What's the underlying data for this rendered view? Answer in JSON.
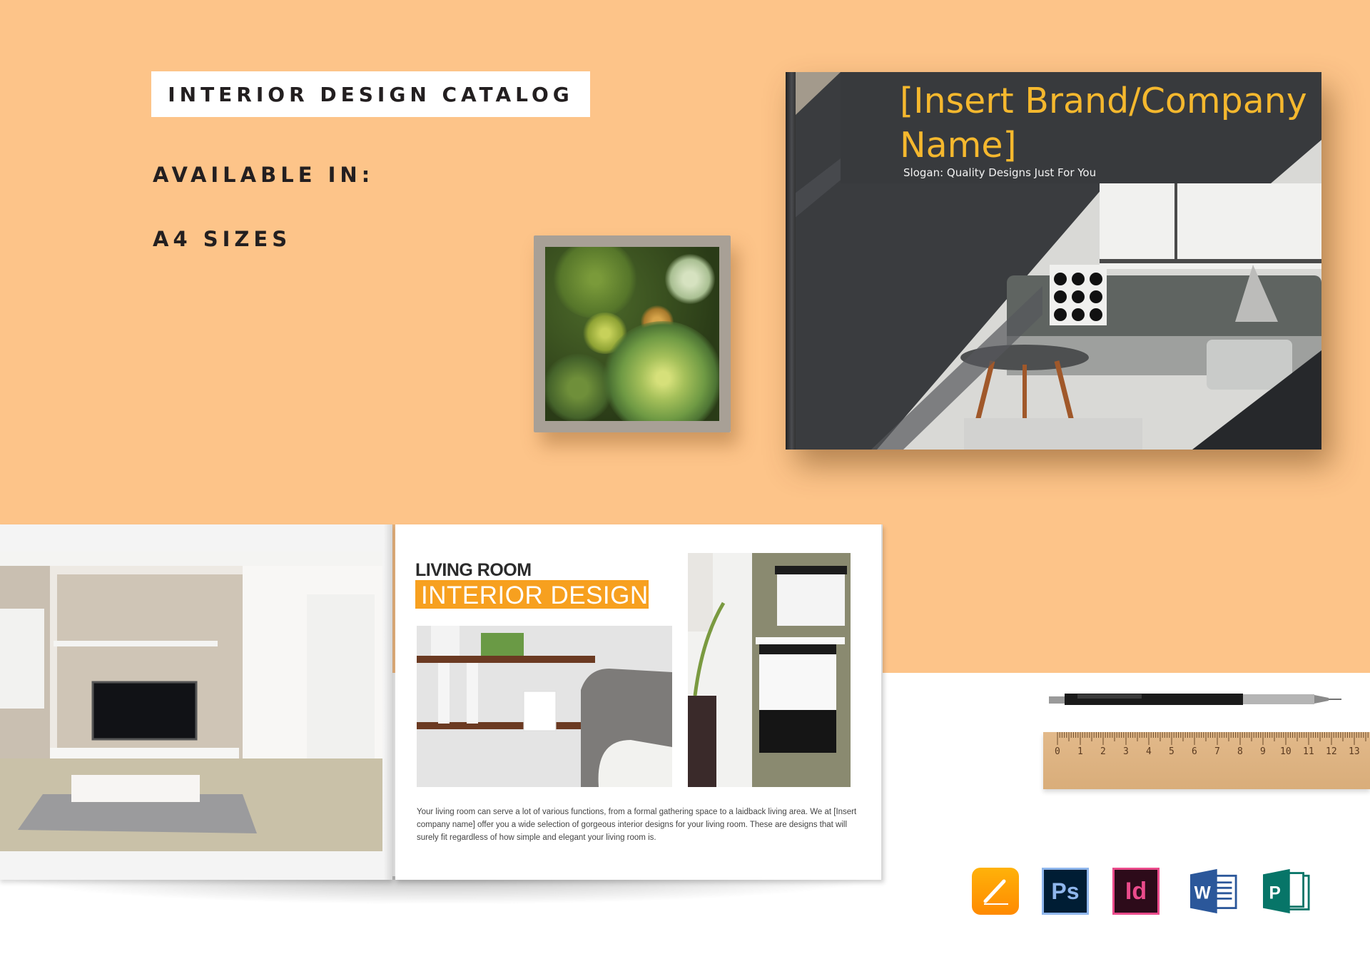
{
  "header": {
    "title": "INTERIOR DESIGN CATALOG",
    "available_label": "AVAILABLE IN:",
    "sizes_label": "A4 SIZES"
  },
  "cover": {
    "brand": "[Insert Brand/Company Name]",
    "slogan": "Slogan: Quality Designs Just For You",
    "brand_color": "#f5b82e",
    "background_color": "#383a3d"
  },
  "spread": {
    "heading_top": "LIVING ROOM",
    "heading_highlight": "INTERIOR DESIGN",
    "highlight_color": "#f7a01f",
    "body": "Your living room can serve a lot of various functions, from a formal gathering space to a laidback living area. We at [Insert company name] offer you a wide selection of gorgeous interior designs for your living room. These are designs that will surely fit regardless of how simple and elegant your living room is."
  },
  "ruler": {
    "labels": [
      "0",
      "1",
      "2",
      "3",
      "4",
      "5",
      "6",
      "7",
      "8",
      "9",
      "10",
      "11",
      "12",
      "13"
    ]
  },
  "apps": [
    {
      "name": "apple-pages-icon",
      "label": ""
    },
    {
      "name": "photoshop-icon",
      "label": "Ps"
    },
    {
      "name": "indesign-icon",
      "label": "Id"
    },
    {
      "name": "word-icon",
      "label": "W"
    },
    {
      "name": "publisher-icon",
      "label": "P"
    }
  ],
  "colors": {
    "background_orange": "#fdc489",
    "background_white": "#ffffff",
    "text_dark": "#231f20"
  }
}
